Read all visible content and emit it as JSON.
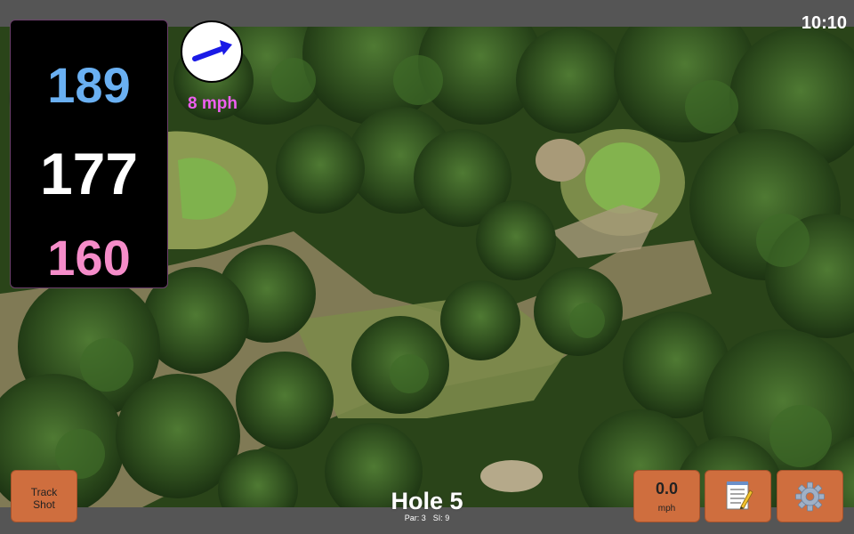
{
  "status": {
    "clock": "10:10"
  },
  "yardage": {
    "back": "189",
    "center": "177",
    "front": "160"
  },
  "wind": {
    "speed": "8 mph",
    "direction_icon": "wind-arrow-icon"
  },
  "hole": {
    "title": "Hole 5",
    "par": "Par: 3",
    "stroke_index": "SI: 9"
  },
  "buttons": {
    "track_shot": "Track\nShot",
    "speed_value": "0.0",
    "speed_unit": "mph",
    "notes_icon": "notepad-icon",
    "settings_icon": "gear-icon"
  },
  "colors": {
    "back_yardage": "#6ab0f2",
    "center_yardage": "#ffffff",
    "front_yardage": "#f58cc9",
    "wind_text": "#ee5ff0",
    "button": "#cf6e3e"
  }
}
